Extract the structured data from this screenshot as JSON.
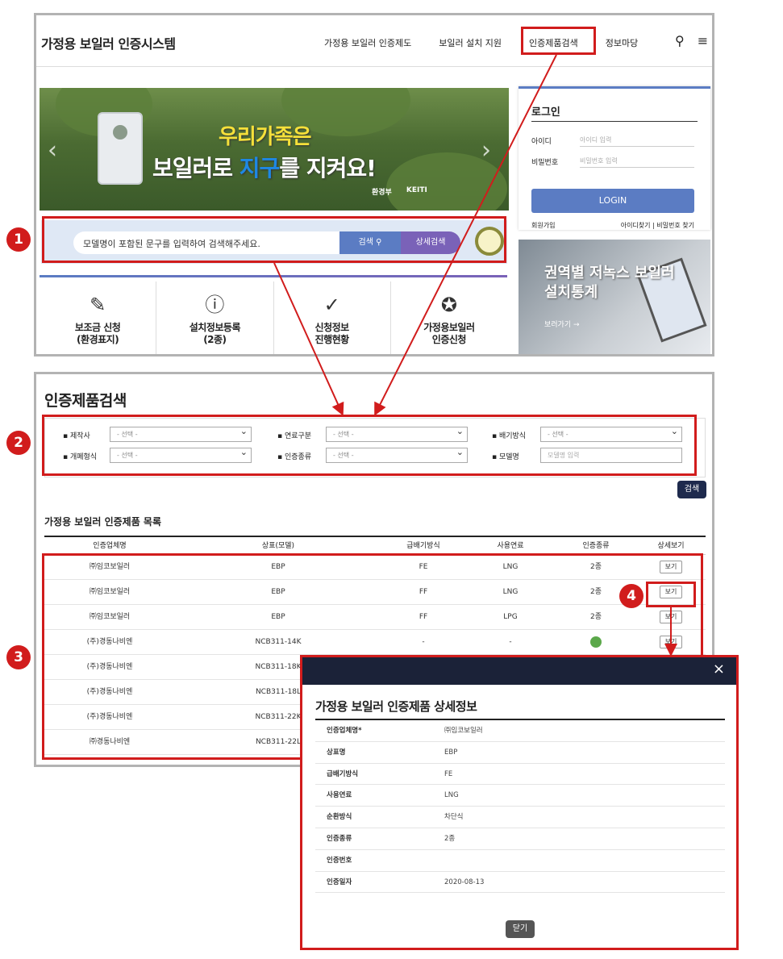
{
  "site": {
    "title": "가정용 보일러 인증시스템",
    "nav": [
      "가정용 보일러 인증제도",
      "보일러 설치 지원",
      "인증제품검색",
      "정보마당"
    ]
  },
  "banner": {
    "line1": "우리가족은",
    "line2_a": "보일러로 ",
    "line2_b": "지구",
    "line2_c": "를 지켜요!",
    "logo1": "환경부",
    "logo2": "KEITI"
  },
  "search": {
    "placeholder": "모델명이 포함된 문구를 입력하여 검색해주세요.",
    "search_label": "검색",
    "advanced_label": "상세검색"
  },
  "quick_links": [
    {
      "label": "보조금 신청\n(환경표지)",
      "icon": "pencil-icon"
    },
    {
      "label": "설치정보등록\n(2종)",
      "icon": "info-icon"
    },
    {
      "label": "신청정보\n진행현황",
      "icon": "check-circle-icon"
    },
    {
      "label": "가정용보일러\n인증신청",
      "icon": "award-icon"
    }
  ],
  "login": {
    "title": "로그인",
    "id_label": "아이디",
    "id_placeholder": "아이디 입력",
    "pw_label": "비밀번호",
    "pw_placeholder": "비밀번호 입력",
    "button": "LOGIN",
    "join": "회원가입",
    "find_id": "아이디찾기",
    "find_pw": "비밀번호 찾기"
  },
  "stat_banner": {
    "title_line1": "권역별 저녹스 보일러",
    "title_line2": "설치통계",
    "link": "보러가기"
  },
  "search_page": {
    "title": "인증제품검색",
    "filters": {
      "maker": "제작사",
      "fuel": "연료구분",
      "exhaust": "배기방식",
      "open_type": "개폐형식",
      "cert_type": "인증종류",
      "model": "모델명",
      "select_default": "- 선택 -",
      "model_placeholder": "모델명 입력"
    },
    "search_button": "검색",
    "list_title": "가정용 보일러 인증제품 목록",
    "columns": [
      "인증업체명",
      "상표(모델)",
      "급배기방식",
      "사용연료",
      "인증종류",
      "상세보기"
    ],
    "view_label": "보기",
    "rows": [
      {
        "company": "㈜임코보일러",
        "model": "EBP",
        "exhaust": "FE",
        "fuel": "LNG",
        "cert": "2종"
      },
      {
        "company": "㈜임코보일러",
        "model": "EBP",
        "exhaust": "FF",
        "fuel": "LNG",
        "cert": "2종"
      },
      {
        "company": "㈜임코보일러",
        "model": "EBP",
        "exhaust": "FF",
        "fuel": "LPG",
        "cert": "2종"
      },
      {
        "company": "(주)경동나비엔",
        "model": "NCB311-14K",
        "exhaust": "-",
        "fuel": "-",
        "cert": ""
      },
      {
        "company": "(주)경동나비엔",
        "model": "NCB311-18K",
        "exhaust": "",
        "fuel": "",
        "cert": ""
      },
      {
        "company": "(주)경동나비엔",
        "model": "NCB311-18L",
        "exhaust": "",
        "fuel": "",
        "cert": ""
      },
      {
        "company": "(주)경동나비엔",
        "model": "NCB311-22K",
        "exhaust": "",
        "fuel": "",
        "cert": ""
      },
      {
        "company": "㈜경동나비엔",
        "model": "NCB311-22L",
        "exhaust": "",
        "fuel": "",
        "cert": ""
      }
    ]
  },
  "modal": {
    "title": "가정용 보일러 인증제품 상세정보",
    "close_x": "×",
    "close_button": "닫기",
    "rows": [
      {
        "key": "인증업체명*",
        "value": "㈜임코보일러"
      },
      {
        "key": "상표명",
        "value": "EBP"
      },
      {
        "key": "급배기방식",
        "value": "FE"
      },
      {
        "key": "사용연료",
        "value": "LNG"
      },
      {
        "key": "순환방식",
        "value": "차단식"
      },
      {
        "key": "인증종류",
        "value": "2종"
      },
      {
        "key": "인증번호",
        "value": ""
      },
      {
        "key": "인증일자",
        "value": "2020-08-13"
      }
    ]
  },
  "annotations": {
    "badges": [
      "1",
      "2",
      "3",
      "4"
    ],
    "color": "#d11c1c"
  }
}
